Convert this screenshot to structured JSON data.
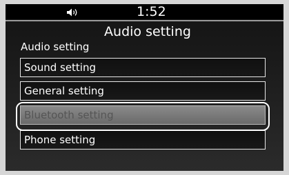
{
  "status_bar": {
    "icon": "speaker-volume-icon",
    "time": "1:52"
  },
  "header": {
    "title": "Audio setting"
  },
  "section": {
    "label": "Audio setting"
  },
  "menu": {
    "selected_index": 2,
    "items": [
      {
        "label": "Sound setting"
      },
      {
        "label": "General setting"
      },
      {
        "label": "Bluetooth setting"
      },
      {
        "label": "Phone setting"
      }
    ]
  },
  "colors": {
    "bezel": "#d6d6d6",
    "screen_bg": "#1a1a1a",
    "status_bar_bg": "#000000",
    "selected_item_bg": "#7a7a7a",
    "text": "#ffffff"
  }
}
